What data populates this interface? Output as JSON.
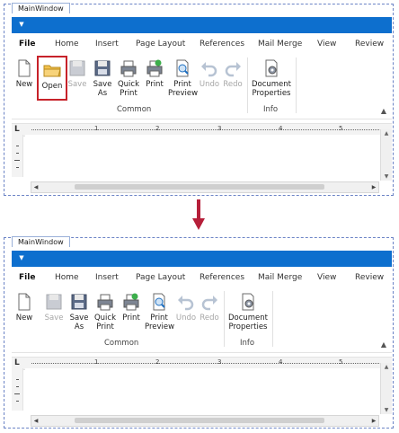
{
  "window": {
    "title": "MainWindow"
  },
  "tabs": [
    "File",
    "Home",
    "Insert",
    "Page Layout",
    "References",
    "Mail Merge",
    "View",
    "Review"
  ],
  "groups": {
    "common": "Common",
    "info": "Info"
  },
  "buttons": {
    "new": [
      "New"
    ],
    "open": [
      "Open"
    ],
    "save": [
      "Save"
    ],
    "save_as": [
      "Save",
      "As"
    ],
    "quick_print": [
      "Quick",
      "Print"
    ],
    "print": [
      "Print"
    ],
    "print_preview": [
      "Print",
      "Preview"
    ],
    "undo": [
      "Undo"
    ],
    "redo": [
      "Redo"
    ],
    "document_properties": [
      "Document",
      "Properties"
    ]
  },
  "ruler": {
    "numbers": [
      "1",
      "2",
      "3",
      "4",
      "5"
    ],
    "tab_marker": "L"
  },
  "colors": {
    "accent": "#0d6fce",
    "highlight": "#c7222a",
    "arrow": "#b61f3a"
  },
  "icons": {
    "new": "blank-page-icon",
    "open": "folder-icon",
    "save": "floppy-disk-icon",
    "print": "printer-icon",
    "preview": "magnifier-page-icon",
    "undo": "undo-arrow-icon",
    "redo": "redo-arrow-icon",
    "properties": "gear-document-icon"
  },
  "states": {
    "before": {
      "open_highlighted": true
    },
    "after": {
      "open_visible": false
    }
  }
}
